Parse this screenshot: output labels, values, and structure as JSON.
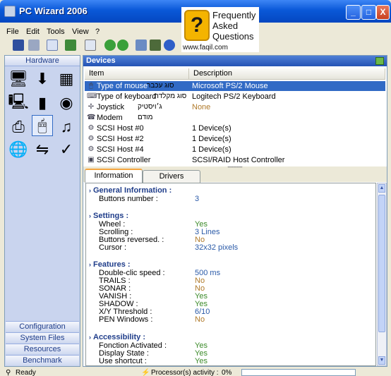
{
  "window": {
    "title": "PC Wizard 2006",
    "buttons": {
      "minimize": "_",
      "maximize": "□",
      "close": "X"
    }
  },
  "faq": {
    "mark": "?",
    "lines": [
      "Frequently",
      "Asked",
      "Questions"
    ],
    "url": "www.faqil.com"
  },
  "menu": [
    "File",
    "Edit",
    "Tools",
    "View",
    "?"
  ],
  "left_panel": {
    "header": "Hardware",
    "icons": [
      "mainboard-icon",
      "processor-icon",
      "chipset-icon",
      "video-icon",
      "drives-icon",
      "disk-icon",
      "printer-icon",
      "devices-icon",
      "sound-icon",
      "network-icon",
      "ports-icon",
      "tweak-icon"
    ],
    "buttons": [
      "Configuration",
      "System Files",
      "Resources",
      "Benchmark"
    ]
  },
  "devices": {
    "header": "Devices",
    "columns": [
      "Item",
      "Description"
    ],
    "rows": [
      {
        "item": "Type of mouse",
        "hebrew": "סוג עכבר",
        "description": "Microsoft PS/2 Mouse",
        "icon": "mouse-icon"
      },
      {
        "item": "Type of keyboard",
        "hebrew": "סוג מקלדת",
        "description": "Logitech PS/2 Keyboard",
        "icon": "keyboard-icon"
      },
      {
        "item": "Joystick",
        "hebrew": "ג׳ויסטיק",
        "description": "None",
        "icon": "joystick-icon"
      },
      {
        "item": "Modem",
        "hebrew": "מודם",
        "description": "",
        "icon": "modem-icon"
      },
      {
        "item": "SCSI Host #0",
        "hebrew": "",
        "description": "1 Device(s)",
        "icon": "scsi-icon"
      },
      {
        "item": "SCSI Host #2",
        "hebrew": "",
        "description": "1 Device(s)",
        "icon": "scsi-icon"
      },
      {
        "item": "SCSI Host #4",
        "hebrew": "",
        "description": "1 Device(s)",
        "icon": "scsi-icon"
      },
      {
        "item": "SCSI Controller",
        "hebrew": "",
        "description": "SCSI/RAID Host Controller",
        "icon": "controller-icon"
      }
    ]
  },
  "tabs": [
    "Information",
    "Drivers"
  ],
  "info": {
    "sections": [
      {
        "title": "General Information :",
        "props": [
          {
            "name": "Buttons number :",
            "value": "3",
            "color": "blue"
          }
        ]
      },
      {
        "title": "Settings :",
        "props": [
          {
            "name": "Wheel :",
            "value": "Yes",
            "color": "green"
          },
          {
            "name": "Scrolling :",
            "value": "3 Lines",
            "color": "blue"
          },
          {
            "name": "Buttons reversed. :",
            "value": "No",
            "color": "orange"
          },
          {
            "name": "Cursor :",
            "value": "32x32 pixels",
            "color": "blue"
          }
        ]
      },
      {
        "title": "Features :",
        "props": [
          {
            "name": "Double-clic speed :",
            "value": "500 ms",
            "color": "blue"
          },
          {
            "name": "TRAILS :",
            "value": "No",
            "color": "orange"
          },
          {
            "name": "SONAR :",
            "value": "No",
            "color": "orange"
          },
          {
            "name": "VANISH :",
            "value": "Yes",
            "color": "green"
          },
          {
            "name": "SHADOW :",
            "value": "Yes",
            "color": "green"
          },
          {
            "name": "X/Y Threshold :",
            "value": "6/10",
            "color": "blue"
          },
          {
            "name": "PEN Windows :",
            "value": "No",
            "color": "orange"
          }
        ]
      },
      {
        "title": "Accessibility :",
        "props": [
          {
            "name": "Fonction Activated :",
            "value": "Yes",
            "color": "green"
          },
          {
            "name": "Display State :",
            "value": "Yes",
            "color": "green"
          },
          {
            "name": "Use shortcut :",
            "value": "Yes",
            "color": "green"
          }
        ]
      }
    ]
  },
  "status": {
    "ready": "Ready",
    "activity_label": "Processor(s) activity :",
    "activity_value": "0%"
  },
  "colors": {
    "title_bar": "#0a58d8",
    "selection": "#316ac5",
    "section": "#1f3d8a",
    "yes": "#3c8b2a",
    "no": "#b07a2a",
    "value": "#2a5aa8"
  }
}
